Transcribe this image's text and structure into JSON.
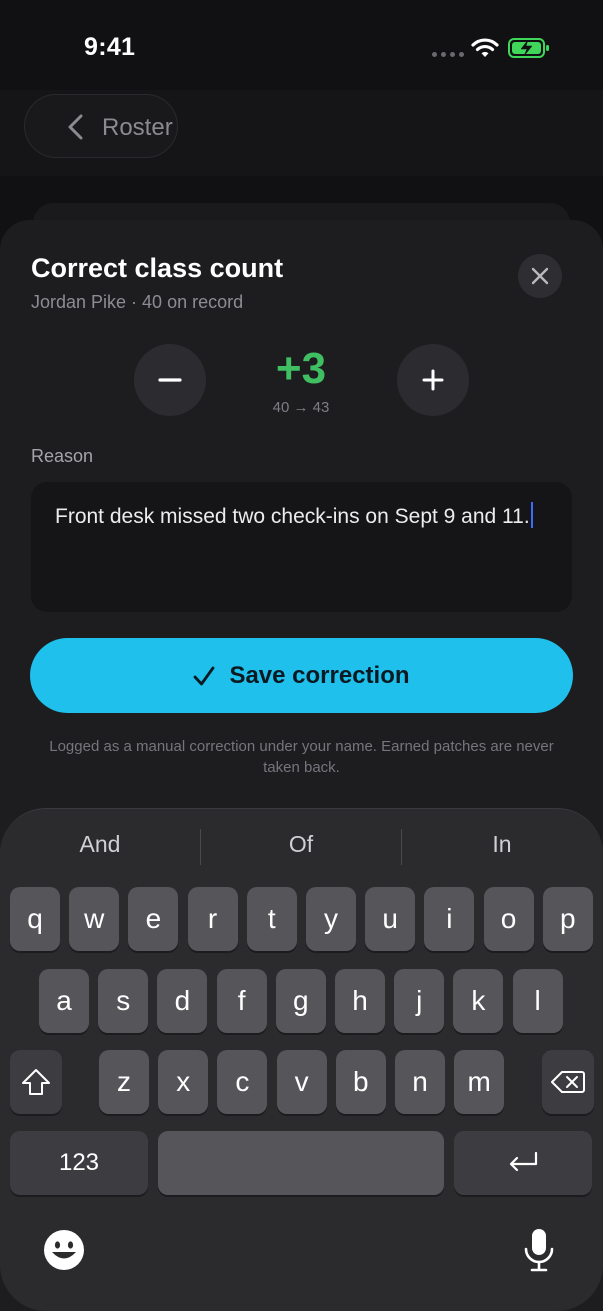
{
  "status_bar": {
    "time": "9:41"
  },
  "nav": {
    "back_label": "Roster"
  },
  "sheet": {
    "title": "Correct class count",
    "subtitle": "Jordan Pike · 40 on record",
    "delta": "+3",
    "range": "40 → 43",
    "reason_label": "Reason",
    "reason_value": "Front desk missed two check-ins on Sept 9 and 11.",
    "save_label": "Save correction",
    "note": "Logged as a manual correction under your name. Earned patches are never taken back."
  },
  "keyboard": {
    "suggestions": [
      "And",
      "Of",
      "In"
    ],
    "row1": [
      "q",
      "w",
      "e",
      "r",
      "t",
      "y",
      "u",
      "i",
      "o",
      "p"
    ],
    "row2": [
      "a",
      "s",
      "d",
      "f",
      "g",
      "h",
      "j",
      "k",
      "l"
    ],
    "row3": [
      "z",
      "x",
      "c",
      "v",
      "b",
      "n",
      "m"
    ],
    "numbers_key": "123"
  },
  "colors": {
    "accent": "#1fc0ec",
    "delta_green": "#3fbf62",
    "battery_green": "#3fd65a",
    "caret": "#3b6cff"
  },
  "icons": [
    "signal-dots-icon",
    "wifi-icon",
    "battery-charging-icon",
    "chevron-left-icon",
    "close-icon",
    "minus-icon",
    "plus-icon",
    "checkmark-icon",
    "shift-icon",
    "backspace-icon",
    "return-icon",
    "emoji-icon",
    "microphone-icon"
  ]
}
